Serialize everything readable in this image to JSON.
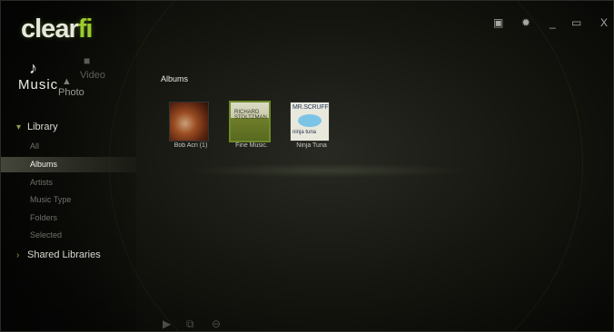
{
  "app": {
    "logo_main": "clear",
    "logo_accent": "fi",
    "accent_color": "#9ccc2c"
  },
  "modes": [
    {
      "label": "Music",
      "icon": "music-note-icon",
      "active": true
    },
    {
      "label": "Video",
      "icon": "video-icon",
      "active": false
    },
    {
      "label": "Photo",
      "icon": "photo-icon",
      "active": false
    }
  ],
  "nav": {
    "library": {
      "label": "Library",
      "icon": "chevron-down-icon"
    },
    "items": [
      {
        "label": "All",
        "active": false
      },
      {
        "label": "Albums",
        "active": true
      },
      {
        "label": "Artists",
        "active": false
      },
      {
        "label": "Music Type",
        "active": false
      },
      {
        "label": "Folders",
        "active": false
      },
      {
        "label": "Selected",
        "active": false
      }
    ],
    "shared": {
      "label": "Shared Libraries",
      "icon": "chevron-right-icon"
    }
  },
  "main": {
    "title": "Albums",
    "albums": [
      {
        "caption": "Bob Acri (1)",
        "selected": false
      },
      {
        "caption": "Fine Music.",
        "selected": true,
        "cover_text": [
          "RICHARD",
          "STOLTZMAN"
        ]
      },
      {
        "caption": "Ninja Tuna",
        "selected": false,
        "cover_text": [
          "MR.SCRUFF",
          "ninja tuna"
        ]
      }
    ]
  },
  "toolbar": {
    "icons": [
      "monitor-icon",
      "settings-gear-icon",
      "minimize-icon",
      "restore-icon",
      "close-icon"
    ],
    "glyphs": {
      "monitor": "▣",
      "settings": "✹",
      "minimize": "_",
      "restore": "▭",
      "close": "X"
    }
  },
  "bottom": {
    "icons": [
      "play-icon",
      "add-to-playlist-icon",
      "remove-icon"
    ],
    "glyphs": {
      "play": "▶",
      "add": "⧉",
      "remove": "⊖"
    }
  }
}
